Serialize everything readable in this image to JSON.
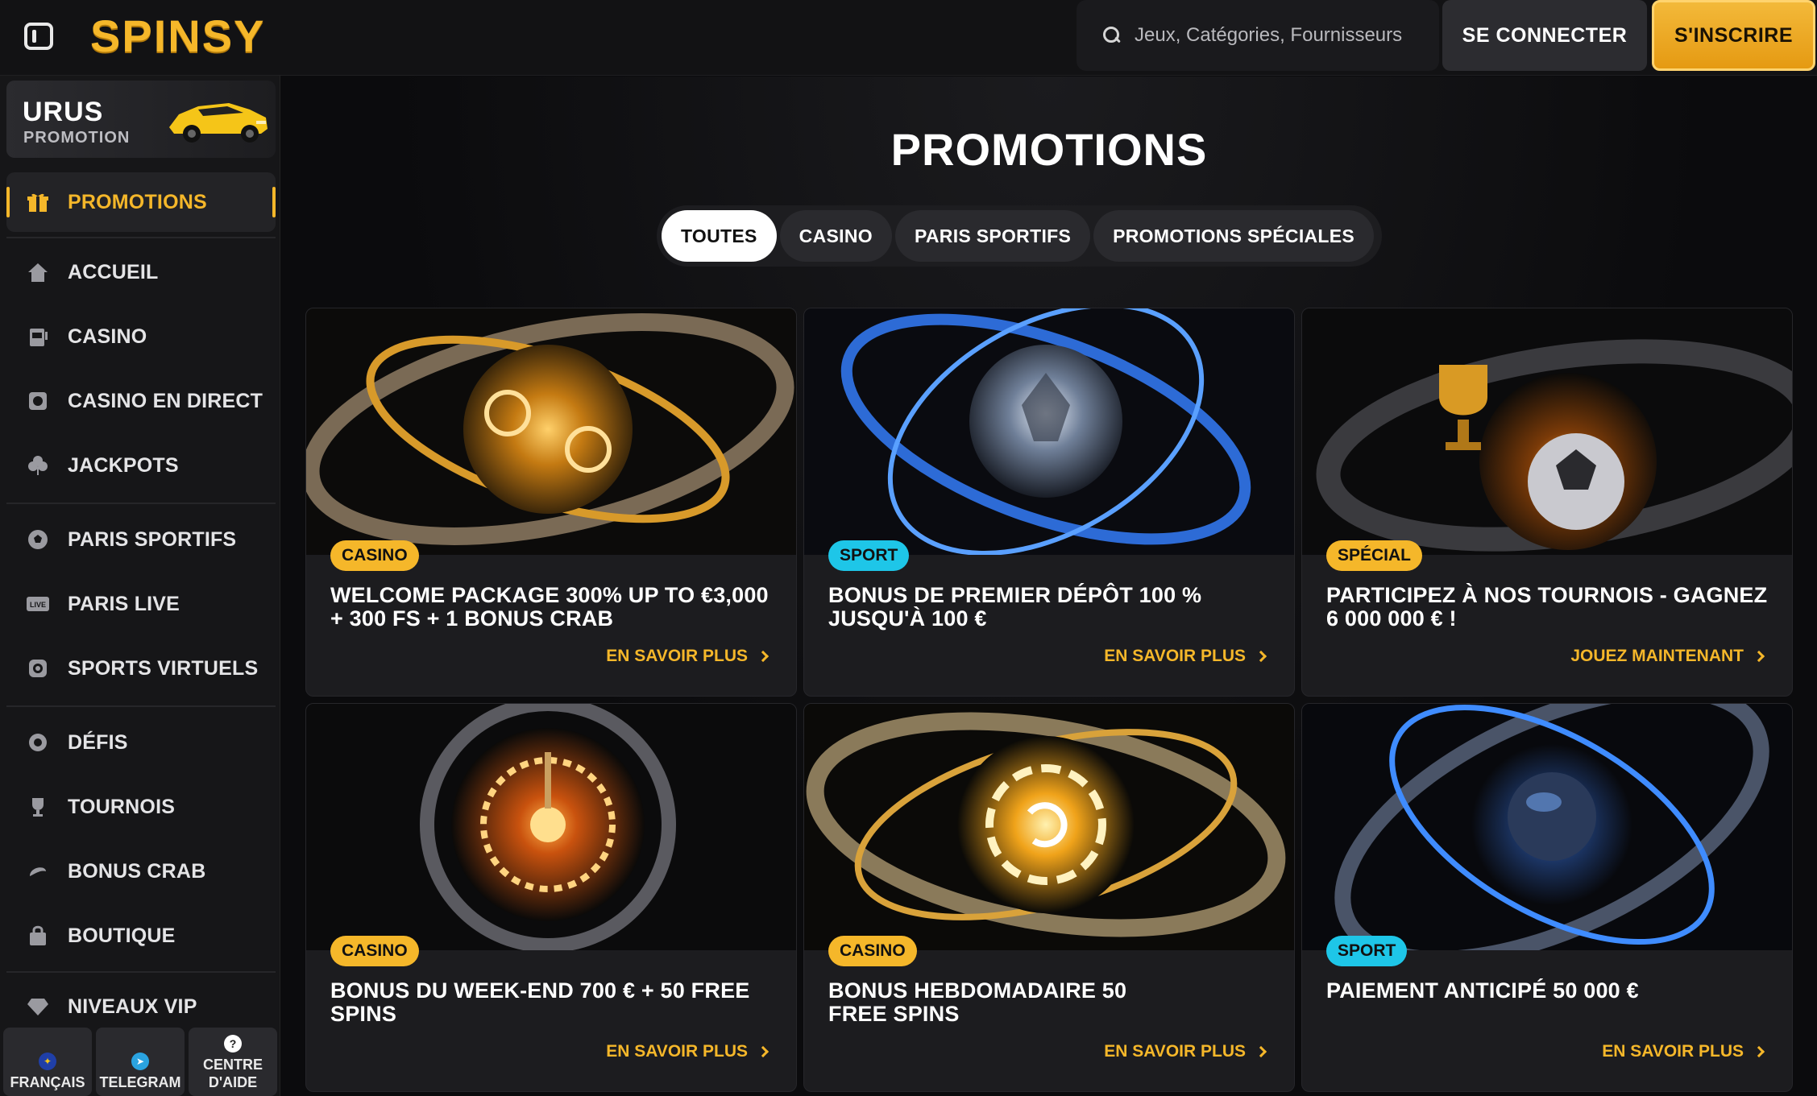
{
  "header": {
    "logo": "SPINSY",
    "search_placeholder": "Jeux, Catégories, Fournisseurs",
    "login_label": "SE CONNECTER",
    "signup_label": "S'INSCRIRE"
  },
  "sidebar": {
    "promo_banner": {
      "title": "URUS",
      "subtitle": "PROMOTION"
    },
    "active_item": {
      "label": "PROMOTIONS",
      "icon": "gift-icon"
    },
    "items": [
      {
        "label": "ACCUEIL",
        "icon": "home-icon"
      },
      {
        "label": "CASINO",
        "icon": "slot-machine-icon"
      },
      {
        "label": "CASINO EN DIRECT",
        "icon": "live-casino-icon"
      },
      {
        "label": "JACKPOTS",
        "icon": "clover-icon"
      },
      {
        "label": "PARIS SPORTIFS",
        "icon": "football-icon"
      },
      {
        "label": "PARIS LIVE",
        "icon": "live-icon"
      },
      {
        "label": "SPORTS VIRTUELS",
        "icon": "virtual-sports-icon"
      },
      {
        "label": "DÉFIS",
        "icon": "challenge-icon"
      },
      {
        "label": "TOURNOIS",
        "icon": "trophy-icon"
      },
      {
        "label": "BONUS CRAB",
        "icon": "crab-icon"
      },
      {
        "label": "BOUTIQUE",
        "icon": "shop-icon"
      },
      {
        "label": "NIVEAUX VIP",
        "icon": "diamond-icon"
      }
    ],
    "footer": [
      {
        "label": "FRANÇAIS",
        "icon": "eu-flag-icon"
      },
      {
        "label": "TELEGRAM",
        "icon": "telegram-icon"
      },
      {
        "label": "CENTRE D'AIDE",
        "icon": "help-icon"
      }
    ]
  },
  "main": {
    "title": "PROMOTIONS",
    "tabs": [
      {
        "label": "TOUTES",
        "active": true
      },
      {
        "label": "CASINO",
        "active": false
      },
      {
        "label": "PARIS SPORTIFS",
        "active": false
      },
      {
        "label": "PROMOTIONS SPÉCIALES",
        "active": false
      }
    ],
    "cards": [
      {
        "badge": "CASINO",
        "title": "WELCOME PACKAGE 300% UP TO €3,000 + 300 FS + 1 BONUS CRAB",
        "cta": "EN SAVOIR PLUS"
      },
      {
        "badge": "SPORT",
        "title": "BONUS DE PREMIER DÉPÔT 100 % JUSQU'À 100 €",
        "cta": "EN SAVOIR PLUS"
      },
      {
        "badge": "SPÉCIAL",
        "title": "PARTICIPEZ À NOS TOURNOIS - GAGNEZ 6 000 000 € !",
        "cta": "JOUEZ MAINTENANT"
      },
      {
        "badge": "CASINO",
        "title": "BONUS DU WEEK-END 700 € + 50 FREE SPINS",
        "cta": "EN SAVOIR PLUS"
      },
      {
        "badge": "CASINO",
        "title": "BONUS HEBDOMADAIRE 50 FREE SPINS",
        "cta": "EN SAVOIR PLUS"
      },
      {
        "badge": "SPORT",
        "title": "PAIEMENT ANTICIPÉ 50 000 €",
        "cta": "EN SAVOIR PLUS"
      }
    ]
  },
  "colors": {
    "accent": "#f5b72a",
    "sport": "#1ec6e8",
    "background": "#0b0b0d"
  }
}
